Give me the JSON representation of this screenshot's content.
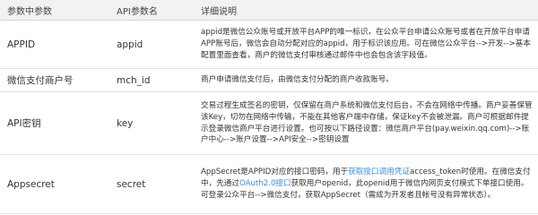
{
  "columns": [
    "参数中参数",
    "API参数名",
    "详细说明"
  ],
  "rows": [
    {
      "name": "APPID",
      "api": "appid",
      "desc": "appid是微信公众账号或开放平台APP的唯一标识，在公众平台申请公众账号或者在开放平台申请APP账号后，微信会自动分配对应的appid，用于标识该应用。可在微信公众平台-->开发-->基本配置里面查看，商户的微信支付审核通过邮件中也会包含该字段值。"
    },
    {
      "name": "微信支付商户号",
      "api": "mch_id",
      "desc": "商户申请微信支付后，由微信支付分配的商户收款账号。"
    },
    {
      "name": "API密钥",
      "api": "key",
      "desc": "交易过程生成签名的密钥，仅保留在商户系统和微信支付后台，不会在网络中传播。商户妥善保管该Key，切勿在网络中传输，不能在其他客户端中存储，保证key不会被泄漏。商户可根据邮件提示登录微信商户平台进行设置。也可按以下路径设置：微信商户平台(pay.weixin.qq.com)-->账户中心-->账户设置-->API安全-->密钥设置"
    },
    {
      "name": "Appsecret",
      "api": "secret",
      "desc_1": "AppSecret是APPID对应的接口密码，用于",
      "desc_link1": "获取接口调用凭证",
      "desc_2": "access_token时使用。在微信支付中，先通过",
      "desc_link2": "OAuth2.0接口",
      "desc_3": "获取用户openid，此openid用于微信内网页支付模式下单接口使用。可登录公众平台-->微信支付，获取AppSecret（需成为开发者且帐号没有异常状态）。"
    }
  ]
}
